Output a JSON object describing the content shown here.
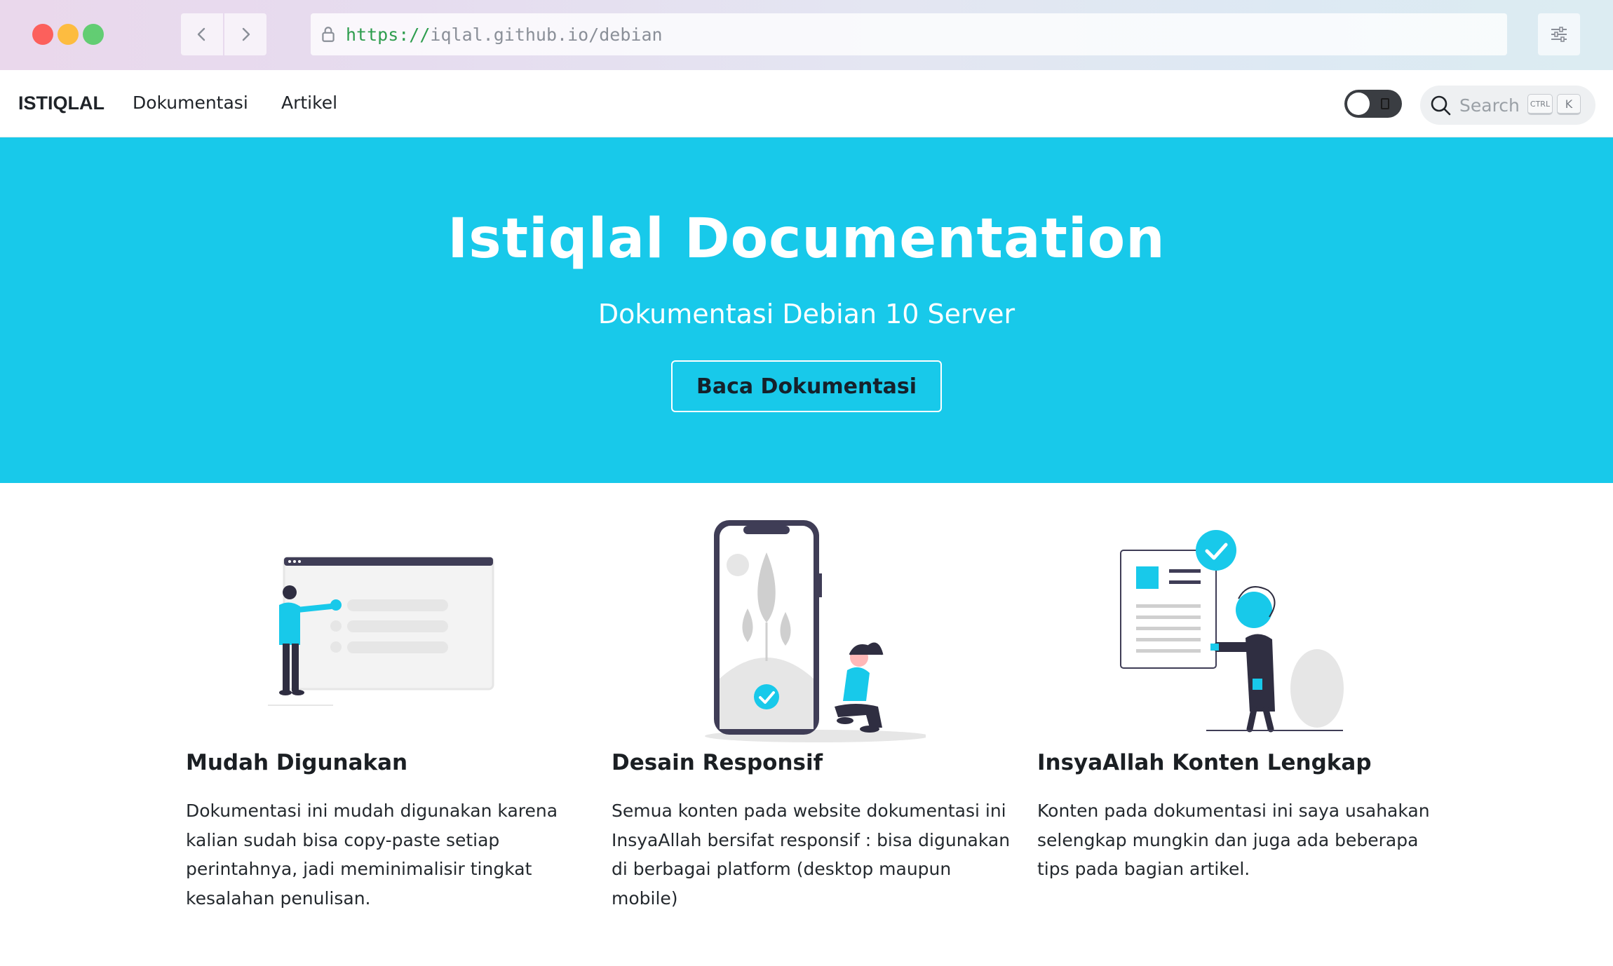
{
  "browser": {
    "url_scheme": "https://",
    "url_rest": "iqlal.github.io/debian",
    "icons": [
      "back-arrow-icon",
      "forward-arrow-icon",
      "lock-icon",
      "sliders-icon"
    ]
  },
  "navbar": {
    "brand": "ISTIQLAL",
    "links": [
      "Dokumentasi",
      "Artikel"
    ],
    "search_placeholder": "Search",
    "search_kbd_ctrl": "CTRL",
    "search_kbd_k": "K"
  },
  "hero": {
    "title": "Istiqlal Documentation",
    "subtitle": "Dokumentasi Debian 10 Server",
    "cta": "Baca Dokumentasi",
    "background": "#18c9ea"
  },
  "features": [
    {
      "title": "Mudah Digunakan",
      "text": "Dokumentasi ini mudah digunakan karena kalian sudah bisa copy-paste setiap perintahnya, jadi meminimalisir tingkat kesalahan penulisan."
    },
    {
      "title": "Desain Responsif",
      "text": "Semua konten pada website dokumentasi ini InsyaAllah bersifat responsif : bisa digunakan di berbagai platform (desktop maupun mobile)"
    },
    {
      "title": "InsyaAllah Konten Lengkap",
      "text": "Konten pada dokumentasi ini saya usahakan selengkap mungkin dan juga ada beberapa tips pada bagian artikel."
    }
  ],
  "colors": {
    "accent": "#18c9ea",
    "dark": "#3f3d56",
    "grey": "#e6e6e6"
  }
}
